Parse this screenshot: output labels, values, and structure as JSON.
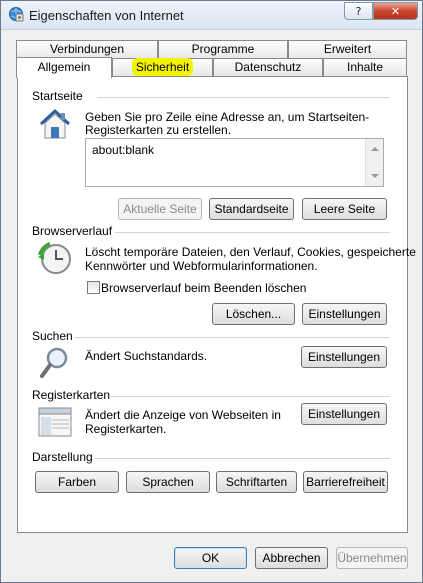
{
  "window": {
    "title": "Eigenschaften von Internet",
    "help_label": "?",
    "close_label": "✕"
  },
  "tabs": {
    "row1": [
      "Verbindungen",
      "Programme",
      "Erweitert"
    ],
    "row2": [
      "Allgemein",
      "Sicherheit",
      "Datenschutz",
      "Inhalte"
    ],
    "active": "Allgemein",
    "highlighted": "Sicherheit",
    "highlight_color": "#f3f200"
  },
  "startseite": {
    "title": "Startseite",
    "description_line1": "Geben Sie pro Zeile eine Adresse an, um Startseiten-",
    "description_line2": "Registerkarten zu erstellen.",
    "address_value": "about:blank",
    "buttons": {
      "current": "Aktuelle Seite",
      "default": "Standardseite",
      "blank": "Leere Seite"
    }
  },
  "browserverlauf": {
    "title": "Browserverlauf",
    "description_line1": "Löscht temporäre Dateien, den Verlauf, Cookies, gespeicherte",
    "description_line2": "Kennwörter und Webformularinformationen.",
    "checkbox_label": "Browserverlauf beim Beenden löschen",
    "checkbox_checked": false,
    "buttons": {
      "delete": "Löschen...",
      "settings": "Einstellungen"
    }
  },
  "suchen": {
    "title": "Suchen",
    "description": "Ändert Suchstandards.",
    "settings_button": "Einstellungen"
  },
  "registerkarten": {
    "title": "Registerkarten",
    "description_line1": "Ändert die Anzeige von Webseiten in",
    "description_line2": "Registerkarten.",
    "settings_button": "Einstellungen"
  },
  "darstellung": {
    "title": "Darstellung",
    "buttons": [
      "Farben",
      "Sprachen",
      "Schriftarten",
      "Barrierefreiheit"
    ]
  },
  "footer": {
    "ok": "OK",
    "cancel": "Abbrechen",
    "apply": "Übernehmen"
  }
}
